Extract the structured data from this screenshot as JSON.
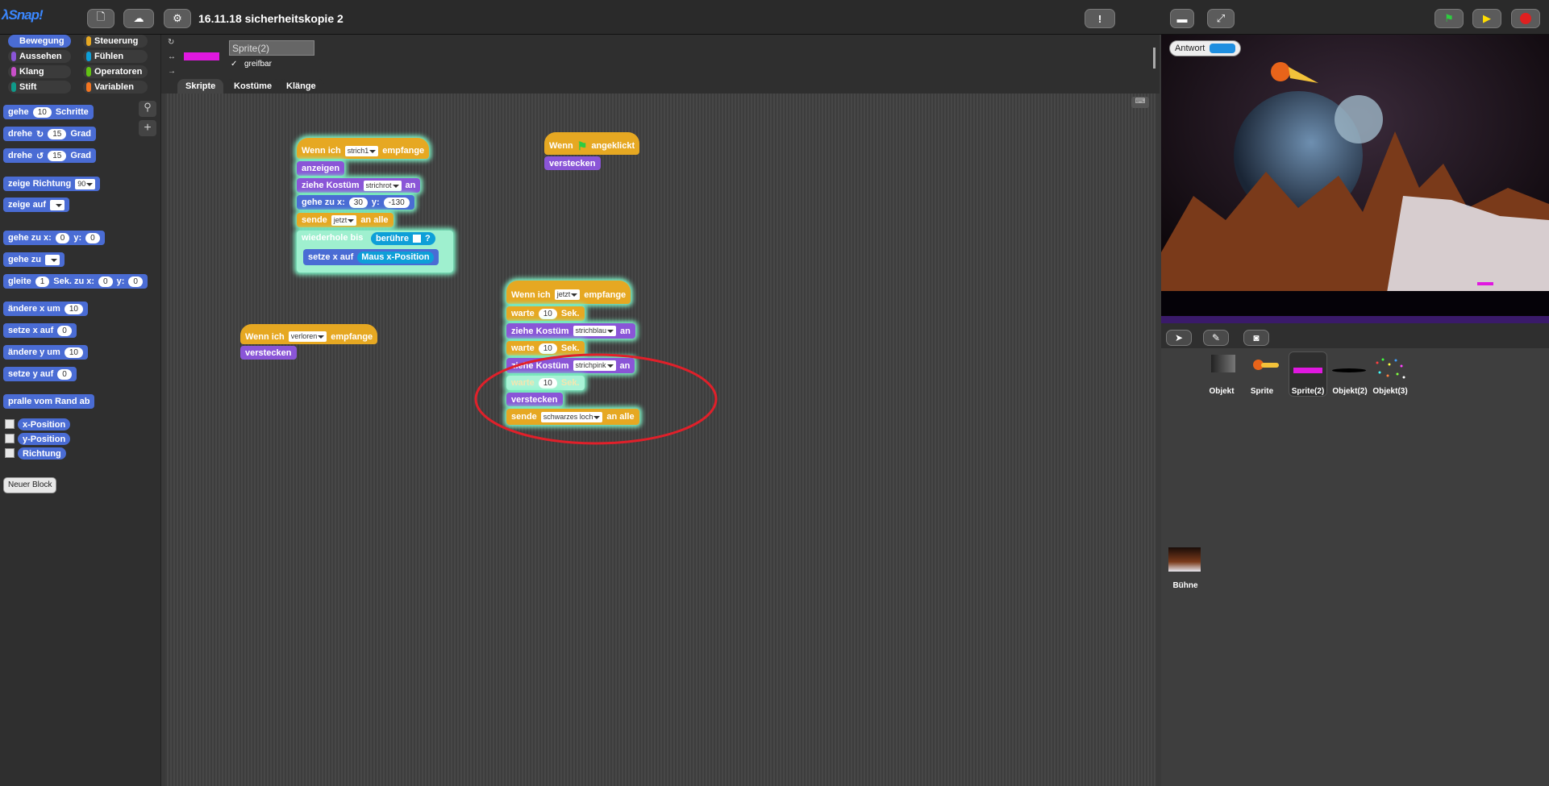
{
  "topbar": {
    "logo": "λSnap!",
    "project_title": "16.11.18 sicherheitskopie 2"
  },
  "palette": {
    "categories": [
      "Bewegung",
      "Steuerung",
      "Aussehen",
      "Fühlen",
      "Klang",
      "Operatoren",
      "Stift",
      "Variablen"
    ],
    "blocks": {
      "gehe": "gehe",
      "gehe_val": "10",
      "schritte": "Schritte",
      "drehe": "drehe",
      "drehe_val": "15",
      "grad": "Grad",
      "zeige_richtung": "zeige Richtung",
      "zeige_richtung_val": "90",
      "zeige_auf": "zeige auf",
      "gehe_zu_x": "gehe zu x:",
      "x0": "0",
      "y_label": "y:",
      "y0": "0",
      "gehe_zu": "gehe zu",
      "gleite": "gleite",
      "gleite_val": "1",
      "sek_zu_x": "Sek. zu x:",
      "aendere_x": "ändere x um",
      "aendere_x_val": "10",
      "setze_x": "setze x auf",
      "setze_x_val": "0",
      "aendere_y": "ändere y um",
      "aendere_y_val": "10",
      "setze_y": "setze y auf",
      "setze_y_val": "0",
      "pralle": "pralle vom Rand ab",
      "xpos": "x-Position",
      "ypos": "y-Position",
      "richtung": "Richtung",
      "neuer_block": "Neuer Block"
    }
  },
  "sprite": {
    "name": "Sprite(2)",
    "draggable_label": "greifbar",
    "tabs": [
      "Skripte",
      "Kostüme",
      "Klänge"
    ]
  },
  "scripts": {
    "s1": {
      "hat": "Wenn ich",
      "hat_msg": "strich1",
      "hat_end": "empfange",
      "anzeigen": "anzeigen",
      "ziehe": "ziehe Kostüm",
      "kostuem": "strichrot",
      "an": "an",
      "gehe_zu_x": "gehe zu x:",
      "x": "30",
      "y_label": "y:",
      "y": "-130",
      "sende": "sende",
      "sende_msg": "jetzt",
      "an_alle": "an alle",
      "wiederhole": "wiederhole bis",
      "beruehre": "berühre",
      "q": "?",
      "setze_x": "setze x auf",
      "maus": "Maus x-Position"
    },
    "s2": {
      "hat": "Wenn",
      "hat_end": "angeklickt",
      "verstecken": "verstecken"
    },
    "s3": {
      "hat": "Wenn ich",
      "hat_msg": "verloren",
      "hat_end": "empfange",
      "verstecken": "verstecken"
    },
    "s4": {
      "hat": "Wenn ich",
      "hat_msg": "jetzt",
      "hat_end": "empfange",
      "warte": "warte",
      "w1": "10",
      "sek": "Sek.",
      "ziehe": "ziehe Kostüm",
      "k1": "strichblau",
      "an": "an",
      "w2": "10",
      "k2": "strichpink",
      "w3": "10",
      "verstecken": "verstecken",
      "sende": "sende",
      "sende_msg": "schwarzes loch",
      "an_alle": "an alle"
    }
  },
  "stage": {
    "watcher_label": "Antwort"
  },
  "corral": {
    "sprites": [
      "Objekt",
      "Sprite",
      "Sprite(2)",
      "Objekt(2)",
      "Objekt(3)"
    ],
    "stage_label": "Bühne"
  },
  "colors": {
    "motion": "#4a6cd4",
    "looks": "#8a55d7",
    "control": "#e6a822",
    "sensing": "#0e9fd8",
    "operators": "#62c213",
    "annotation": "#e0202a"
  }
}
